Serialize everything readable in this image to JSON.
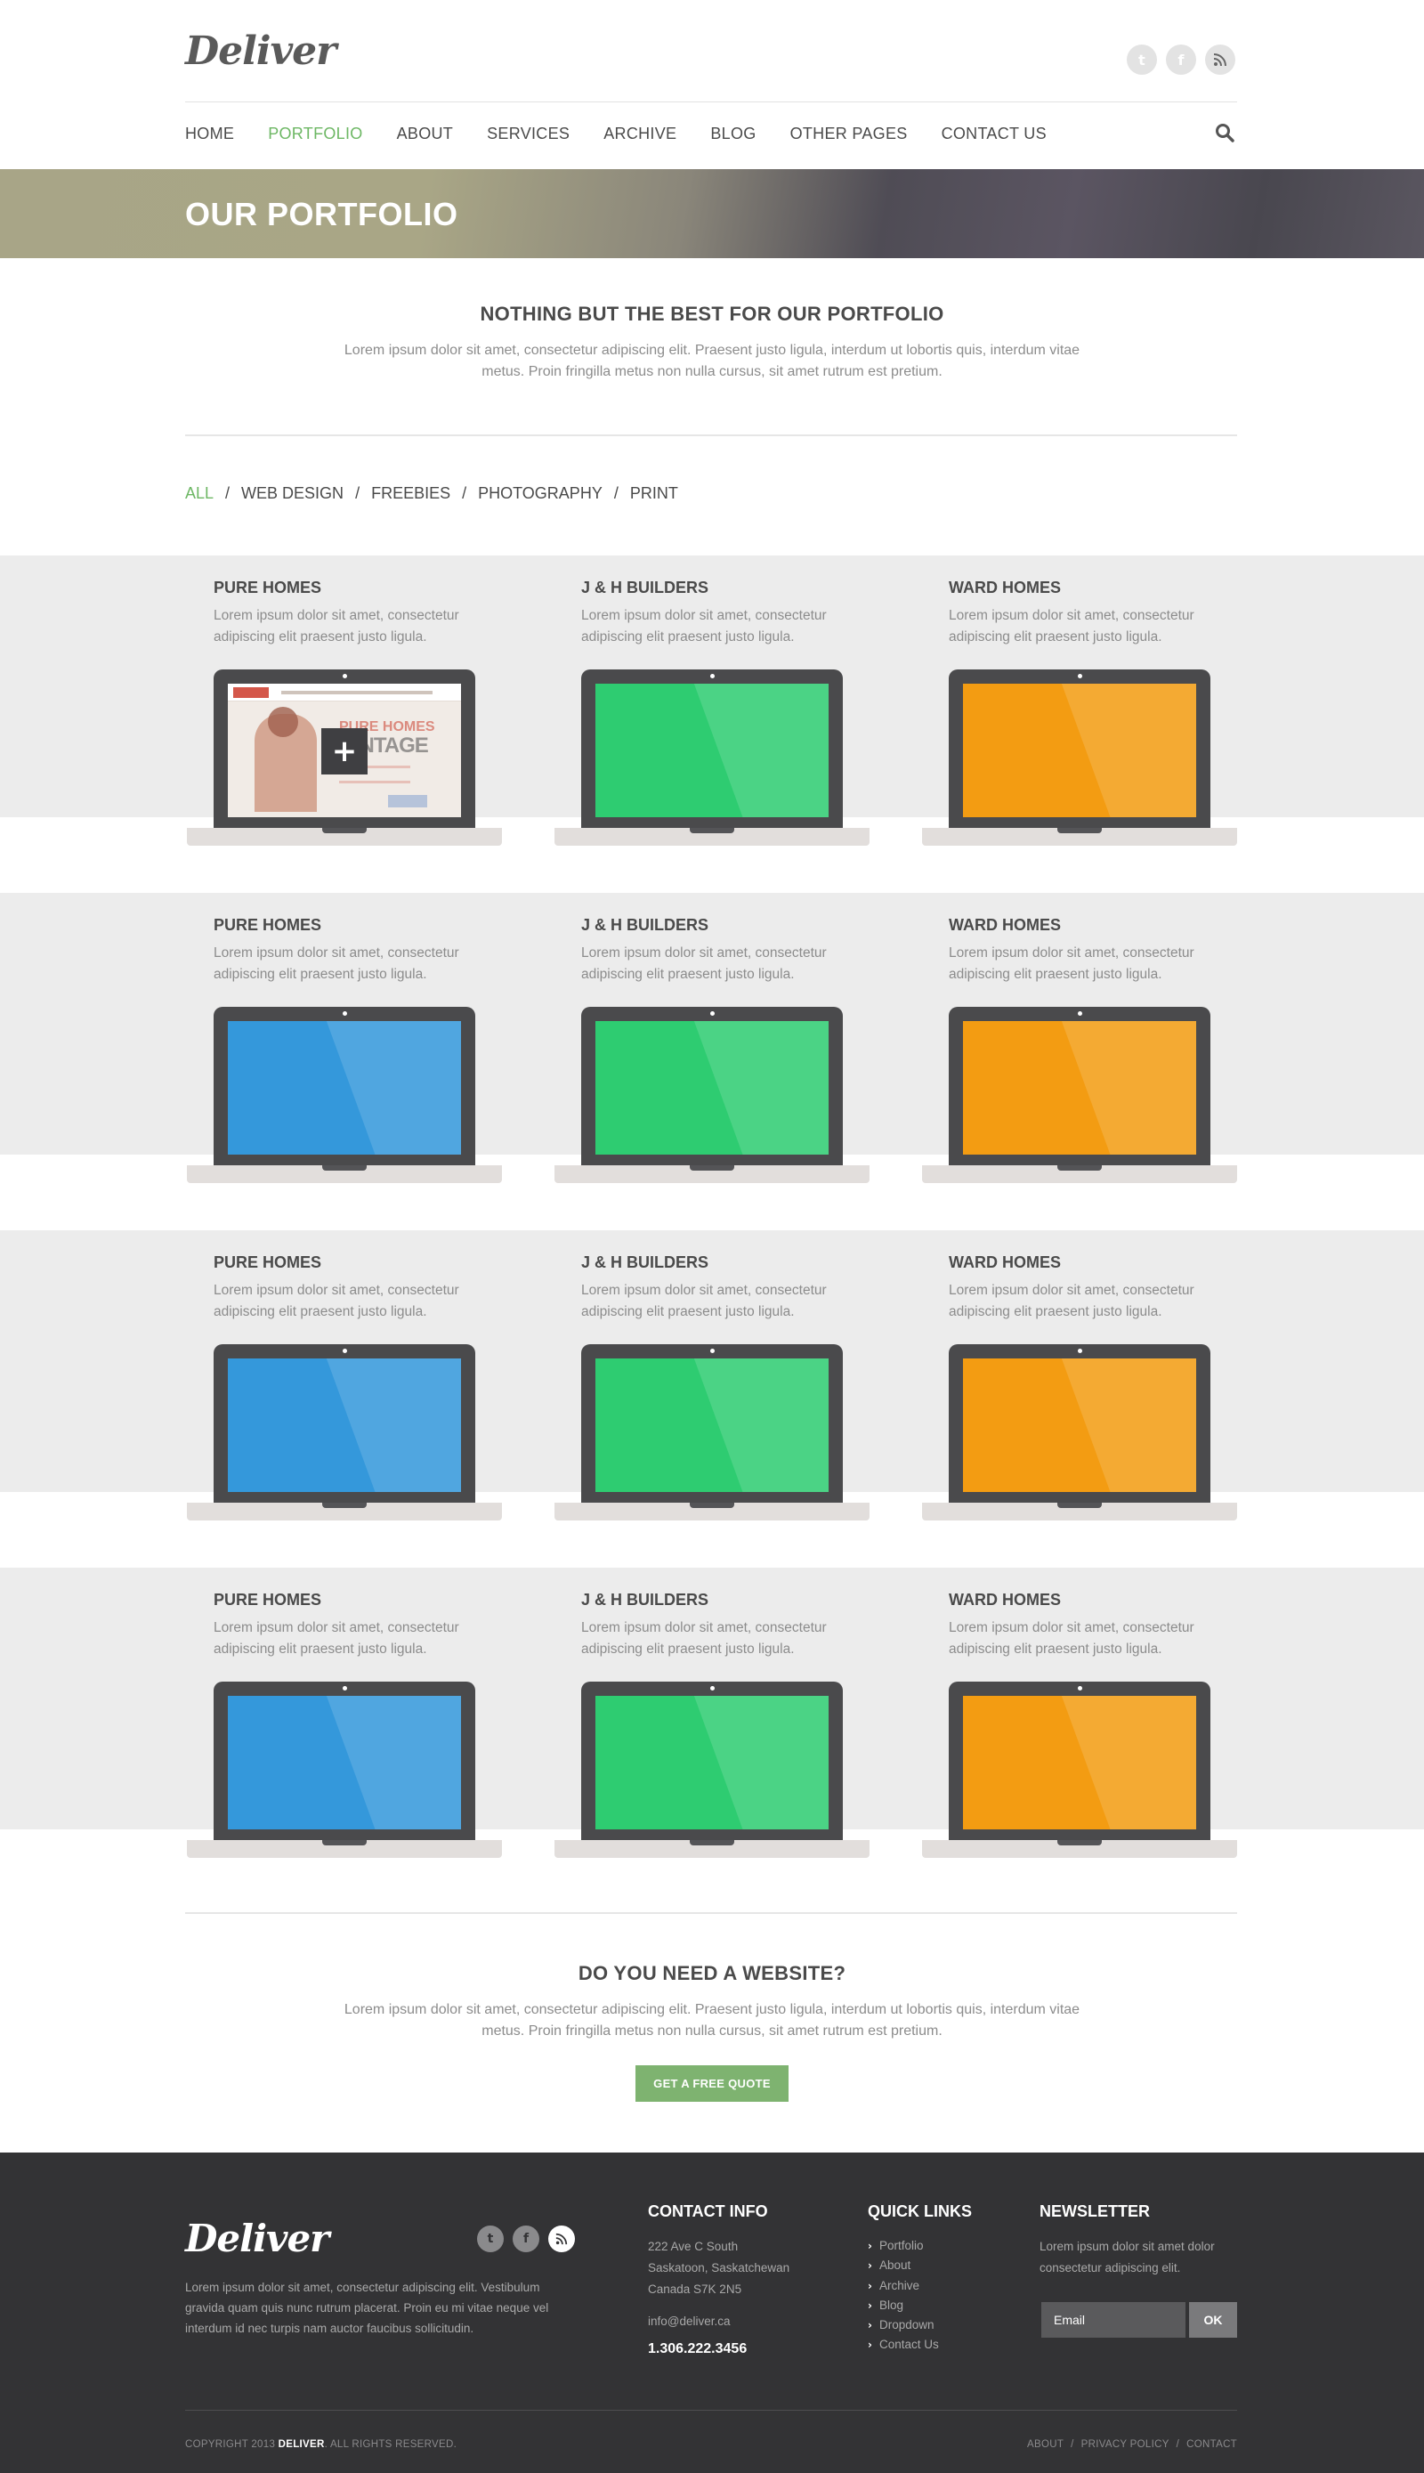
{
  "header": {
    "logo": "Deliver",
    "social": [
      {
        "icon": "twitter-icon",
        "glyph": "t"
      },
      {
        "icon": "facebook-icon",
        "glyph": "f"
      },
      {
        "icon": "rss-icon",
        "glyph": "))"
      }
    ],
    "nav": [
      "HOME",
      "PORTFOLIO",
      "ABOUT",
      "SERVICES",
      "ARCHIVE",
      "BLOG",
      "OTHER PAGES",
      "CONTACT US"
    ],
    "active_nav": "PORTFOLIO"
  },
  "banner": {
    "title": "OUR PORTFOLIO"
  },
  "intro": {
    "title": "NOTHING BUT THE BEST FOR OUR PORTFOLIO",
    "text": "Lorem ipsum dolor sit amet, consectetur adipiscing elit. Praesent justo ligula, interdum ut lobortis quis, interdum vitae metus. Proin fringilla metus non nulla cursus, sit amet rutrum est pretium."
  },
  "filter": {
    "items": [
      "ALL",
      "WEB DESIGN",
      "FREEBIES",
      "PHOTOGRAPHY",
      "PRINT"
    ],
    "active": "ALL",
    "separator": "/"
  },
  "portfolio": {
    "rows": [
      [
        {
          "title": "PURE HOMES",
          "desc": "Lorem ipsum dolor sit amet, consectetur adipiscing elit praesent justo ligula.",
          "screen": "preview"
        },
        {
          "title": "J & H BUILDERS",
          "desc": "Lorem ipsum dolor sit amet, consectetur adipiscing elit praesent justo ligula.",
          "screen": "#2ecc71"
        },
        {
          "title": "WARD HOMES",
          "desc": "Lorem ipsum dolor sit amet, consectetur adipiscing elit praesent justo ligula.",
          "screen": "#f39c12"
        }
      ],
      [
        {
          "title": "PURE HOMES",
          "desc": "Lorem ipsum dolor sit amet, consectetur adipiscing elit praesent justo ligula.",
          "screen": "#3498db"
        },
        {
          "title": "J & H BUILDERS",
          "desc": "Lorem ipsum dolor sit amet, consectetur adipiscing elit praesent justo ligula.",
          "screen": "#2ecc71"
        },
        {
          "title": "WARD HOMES",
          "desc": "Lorem ipsum dolor sit amet, consectetur adipiscing elit praesent justo ligula.",
          "screen": "#f39c12"
        }
      ],
      [
        {
          "title": "PURE HOMES",
          "desc": "Lorem ipsum dolor sit amet, consectetur adipiscing elit praesent justo ligula.",
          "screen": "#3498db"
        },
        {
          "title": "J & H BUILDERS",
          "desc": "Lorem ipsum dolor sit amet, consectetur adipiscing elit praesent justo ligula.",
          "screen": "#2ecc71"
        },
        {
          "title": "WARD HOMES",
          "desc": "Lorem ipsum dolor sit amet, consectetur adipiscing elit praesent justo ligula.",
          "screen": "#f39c12"
        }
      ],
      [
        {
          "title": "PURE HOMES",
          "desc": "Lorem ipsum dolor sit amet, consectetur adipiscing elit praesent justo ligula.",
          "screen": "#3498db"
        },
        {
          "title": "J & H BUILDERS",
          "desc": "Lorem ipsum dolor sit amet, consectetur adipiscing elit praesent justo ligula.",
          "screen": "#2ecc71"
        },
        {
          "title": "WARD HOMES",
          "desc": "Lorem ipsum dolor sit amet, consectetur adipiscing elit praesent justo ligula.",
          "screen": "#f39c12"
        }
      ]
    ],
    "preview": {
      "headline_top": "PURE HOMES",
      "headline_bottom": "VANTAGE",
      "plus": "+"
    }
  },
  "cta": {
    "title": "DO YOU NEED A WEBSITE?",
    "text": "Lorem ipsum dolor sit amet, consectetur adipiscing elit. Praesent justo ligula, interdum ut lobortis quis, interdum vitae metus. Proin fringilla metus non nulla cursus, sit amet rutrum est pretium.",
    "button": "GET A FREE QUOTE"
  },
  "footer": {
    "logo": "Deliver",
    "about": "Lorem ipsum dolor sit amet, consectetur adipiscing elit. Vestibulum gravida quam quis nunc rutrum placerat. Proin eu mi vitae neque vel interdum id nec turpis nam auctor faucibus sollicitudin.",
    "contact": {
      "title": "CONTACT INFO",
      "address_1": "222 Ave C South",
      "address_2": "Saskatoon, Saskatchewan",
      "address_3": "Canada S7K 2N5",
      "email": "info@deliver.ca",
      "phone": "1.306.222.3456"
    },
    "quick_links": {
      "title": "QUICK LINKS",
      "items": [
        "Portfolio",
        "About",
        "Archive",
        "Blog",
        "Dropdown",
        "Contact Us"
      ]
    },
    "newsletter": {
      "title": "NEWSLETTER",
      "text": "Lorem ipsum dolor sit amet dolor consectetur adipiscing elit.",
      "placeholder": "Email",
      "button": "OK"
    },
    "copyright_prefix": "COPYRIGHT 2013",
    "copyright_brand": "DELIVER",
    "copyright_suffix": ". ALL RIGHTS RESERVED.",
    "bottom_links": [
      "ABOUT",
      "PRIVACY POLICY",
      "CONTACT"
    ]
  },
  "colors": {
    "accent": "#6db764",
    "cta_button": "#7eb370",
    "footer_bg": "#333335"
  }
}
